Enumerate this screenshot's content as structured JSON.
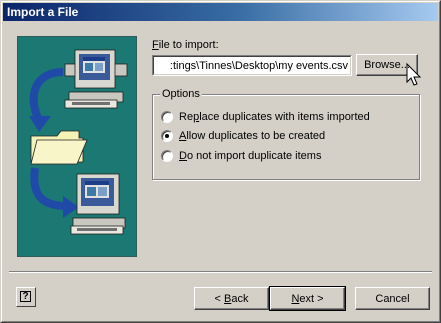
{
  "window": {
    "title": "Import a File"
  },
  "file": {
    "label_prefix": "",
    "label_mnemonic": "F",
    "label_rest": "ile to import:",
    "value": ":tings\\Tinnes\\Desktop\\my events.csv",
    "browse_label": "Browse..."
  },
  "options": {
    "title": "Options",
    "items": [
      {
        "mnemonic": "",
        "pre": "Re",
        "key": "p",
        "post": "lace duplicates with items imported",
        "checked": false
      },
      {
        "mnemonic": "",
        "pre": "",
        "key": "A",
        "post": "llow duplicates to be created",
        "checked": true
      },
      {
        "mnemonic": "",
        "pre": "",
        "key": "D",
        "post": "o not import duplicate items",
        "checked": false
      }
    ]
  },
  "buttons": {
    "back_arrow": "< ",
    "back_key": "B",
    "back_rest": "ack",
    "next_key": "N",
    "next_rest": "ext >",
    "cancel": "Cancel"
  },
  "help": {
    "glyph": "?"
  },
  "colors": {
    "illustration_bg": "#1c7872",
    "arrow": "#1f4aa8",
    "folder": "#f5f2b8"
  },
  "icons": [
    "computer-icon",
    "folder-icon",
    "arrow-icon",
    "help-icon",
    "cursor-icon"
  ]
}
